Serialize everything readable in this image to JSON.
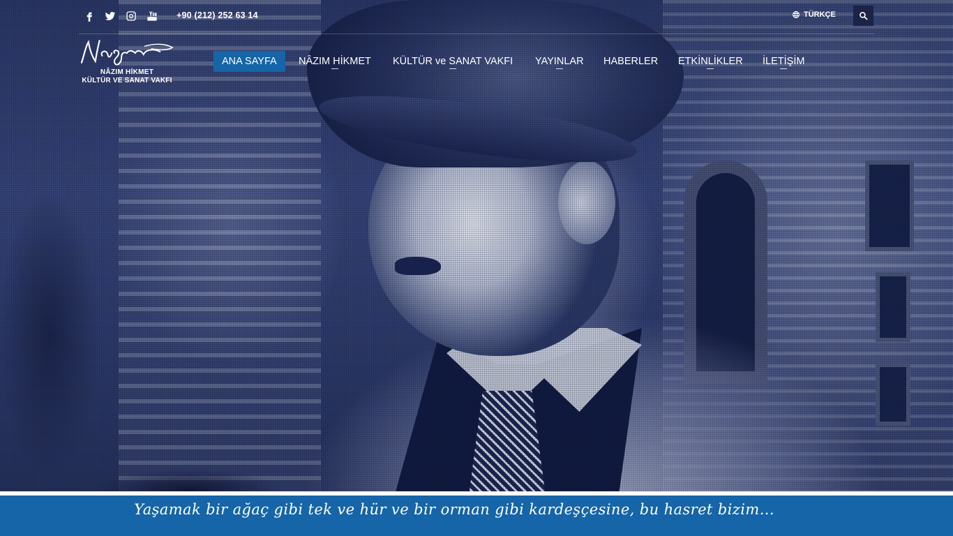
{
  "topbar": {
    "social": [
      {
        "name": "facebook-icon"
      },
      {
        "name": "twitter-icon"
      },
      {
        "name": "instagram-icon"
      },
      {
        "name": "youtube-icon"
      }
    ],
    "phone": "+90 (212) 252 63 14",
    "language": "TÜRKÇE",
    "search_icon": "search-icon"
  },
  "logo": {
    "line1": "NÂZIM HİKMET",
    "line2": "KÜLTÜR VE SANAT VAKFI"
  },
  "nav": {
    "items": [
      {
        "label": "ANA SAYFA",
        "active": true,
        "dropdown": false
      },
      {
        "label": "NÂZIM HİKMET",
        "active": false,
        "dropdown": true
      },
      {
        "label": "KÜLTÜR ve SANAT VAKFI",
        "active": false,
        "dropdown": true
      },
      {
        "label": "YAYINLAR",
        "active": false,
        "dropdown": true
      },
      {
        "label": "HABERLER",
        "active": false,
        "dropdown": false
      },
      {
        "label": "ETKİNLİKLER",
        "active": false,
        "dropdown": true
      },
      {
        "label": "İLETİŞİM",
        "active": false,
        "dropdown": true
      }
    ]
  },
  "quote": {
    "text": "Yaşamak bir ağaç gibi tek ve hür ve bir orman gibi kardeşçesine, bu hasret bizim..."
  },
  "colors": {
    "accent": "#1565a8",
    "overlay": "#1b2347"
  }
}
